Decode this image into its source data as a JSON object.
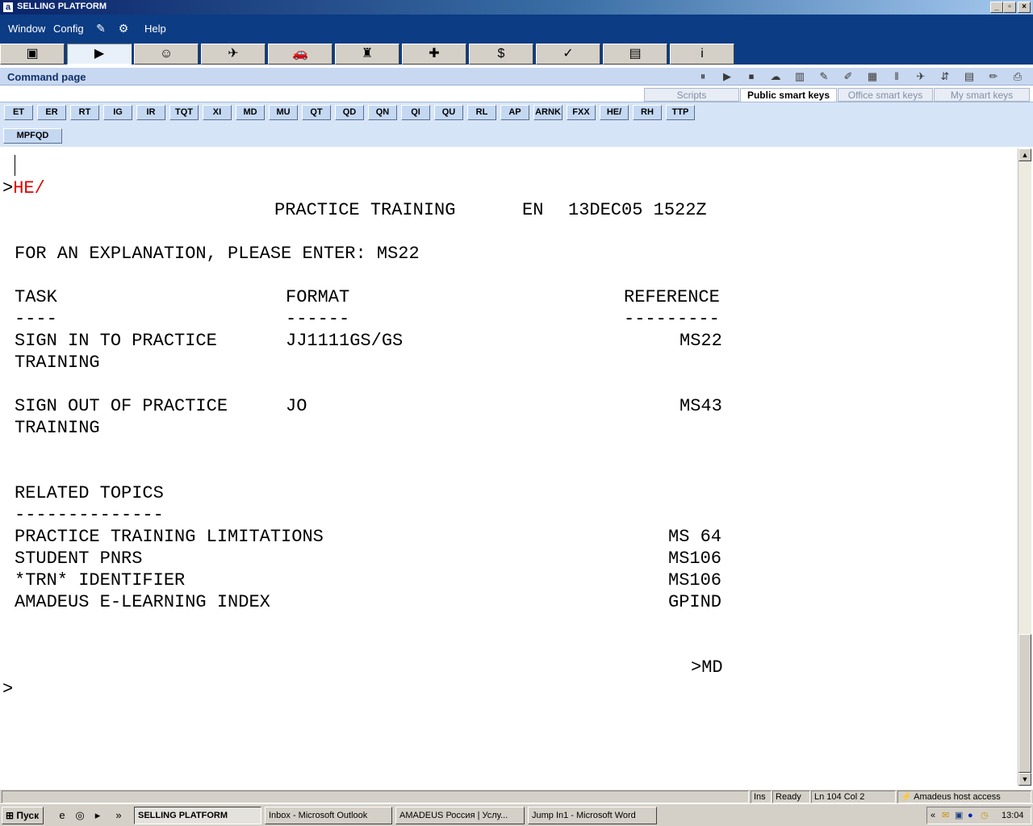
{
  "window": {
    "app_icon": "a",
    "title": "SELLING PLATFORM",
    "minimize": "_",
    "restore": "▫",
    "close": "×"
  },
  "menubar": {
    "window": "Window",
    "config": "Config",
    "help": "Help",
    "icon1": "✎",
    "icon2": "⚙"
  },
  "icontabs": [
    "▣",
    "▶",
    "☺",
    "✈",
    "🚗",
    "♜",
    "✚",
    "$",
    "✓",
    "▤",
    "i"
  ],
  "command_page": {
    "title": "Command page"
  },
  "toolbar_icons": [
    "⏸",
    "▶",
    "⏹",
    "☁",
    "▥",
    "✎",
    "✐",
    "▦",
    "‖",
    "✈",
    "⇵",
    "▤",
    "✏",
    "⎙"
  ],
  "smartkey_tabs": {
    "scripts": "Scripts",
    "public": "Public smart keys",
    "office": "Office smart keys",
    "my": "My smart keys"
  },
  "smartkeys": [
    "ET",
    "ER",
    "RT",
    "IG",
    "IR",
    "TQT",
    "XI",
    "MD",
    "MU",
    "QT",
    "QD",
    "QN",
    "QI",
    "QU",
    "RL",
    "AP",
    "ARNK",
    "FXX",
    "HE/",
    "RH",
    "TTP"
  ],
  "smartkey_row2": "MPFQD",
  "terminal": {
    "prompt": ">",
    "command": "HE/",
    "header_title": "PRACTICE TRAINING",
    "header_lang": "EN",
    "header_date": "13DEC05 1522Z",
    "explanation": "FOR AN EXPLANATION, PLEASE ENTER: MS22",
    "columns": {
      "task": "TASK",
      "format": "FORMAT",
      "reference": "REFERENCE"
    },
    "underlines": {
      "task": "----",
      "format": "------",
      "reference": "---------"
    },
    "rows": [
      {
        "task1": "SIGN IN TO PRACTICE",
        "task2": "TRAINING",
        "format": "JJ1111GS/GS",
        "ref": "MS22"
      },
      {
        "task1": "SIGN OUT OF PRACTICE",
        "task2": "TRAINING",
        "format": "JO",
        "ref": "MS43"
      }
    ],
    "related_title": "RELATED TOPICS",
    "related_underline": "--------------",
    "related": [
      {
        "topic": "PRACTICE TRAINING LIMITATIONS",
        "ref": "MS 64"
      },
      {
        "topic": "STUDENT PNRS",
        "ref": "MS106"
      },
      {
        "topic": "*TRN* IDENTIFIER",
        "ref": "MS106"
      },
      {
        "topic": "AMADEUS E-LEARNING INDEX",
        "ref": "GPIND"
      }
    ],
    "more": ">MD",
    "final_prompt": ">"
  },
  "statusbar": {
    "ins": "Ins",
    "ready": "Ready",
    "position": "Ln 104 Col 2",
    "access": "Amadeus host access",
    "bolt": "⚡"
  },
  "taskbar": {
    "start": "Пуск",
    "quicklaunch": [
      "e",
      "◎",
      "▸"
    ],
    "chevron": "»",
    "tasks": [
      "SELLING PLATFORM",
      "Inbox - Microsoft Outlook",
      "AMADEUS Россия | Услу...",
      "Jump In1 - Microsoft Word"
    ],
    "tray_chevron": "«",
    "clock": "13:04"
  }
}
